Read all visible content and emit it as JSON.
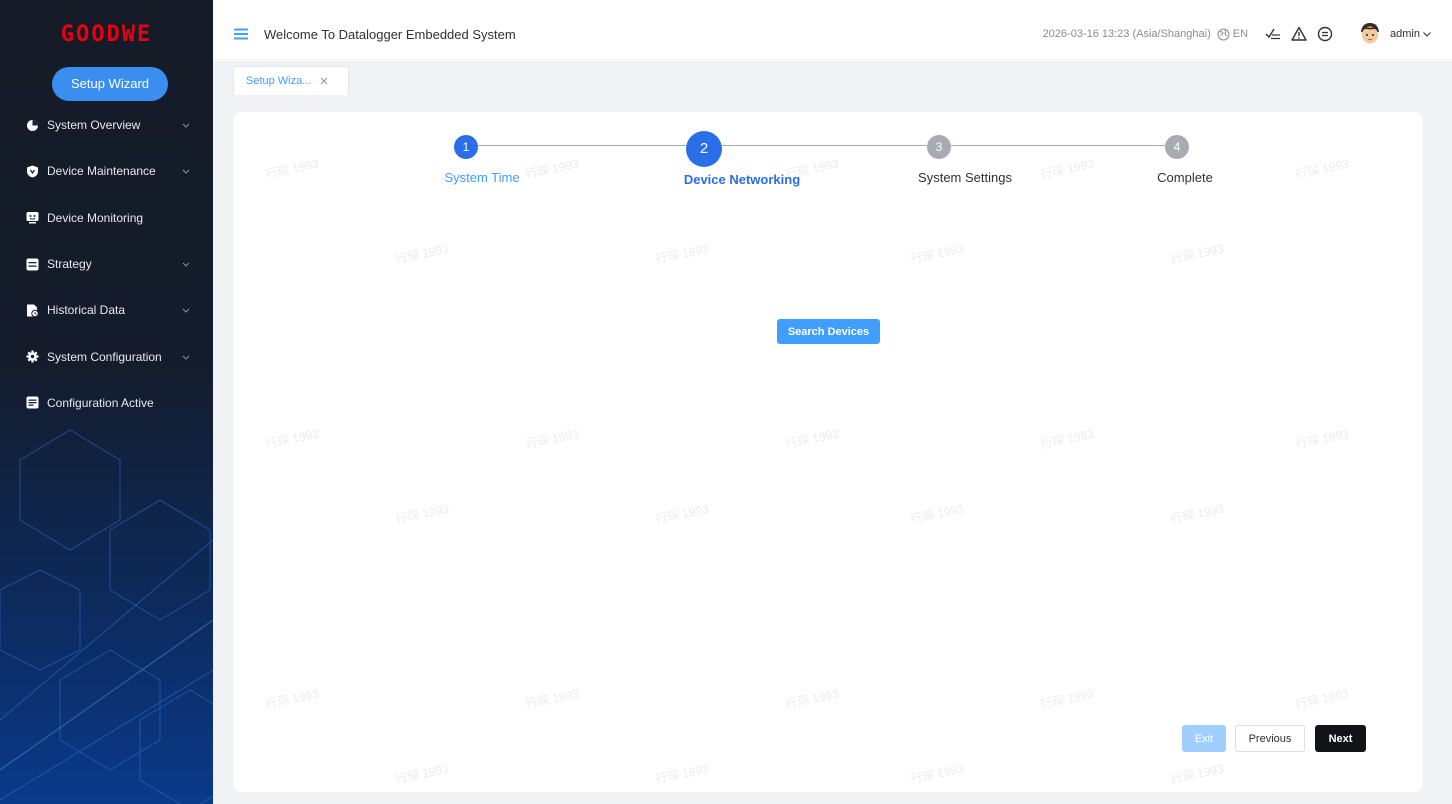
{
  "brand": {
    "logo_text": "GOODWE",
    "logo_color": "#e60012",
    "accent": "#409eff"
  },
  "sidebar": {
    "wizard_button": "Setup Wizard",
    "items": [
      {
        "label": "System Overview",
        "icon": "pie-chart-icon",
        "has_children": true
      },
      {
        "label": "Device Maintenance",
        "icon": "shield-icon",
        "has_children": true
      },
      {
        "label": "Device Monitoring",
        "icon": "monitor-icon",
        "has_children": false
      },
      {
        "label": "Strategy",
        "icon": "strategy-icon",
        "has_children": true
      },
      {
        "label": "Historical Data",
        "icon": "history-icon",
        "has_children": true
      },
      {
        "label": "System Configuration",
        "icon": "gear-icon",
        "has_children": true
      },
      {
        "label": "Configuration Active",
        "icon": "config-active-icon",
        "has_children": false
      }
    ]
  },
  "header": {
    "title": "Welcome To Datalogger Embedded System",
    "datetime": "2026-03-16 13:23 (Asia/Shanghai)",
    "language": "EN",
    "username": "admin"
  },
  "tabs": [
    {
      "label": "Setup Wiza...",
      "active": true
    }
  ],
  "steps": [
    {
      "number": "1",
      "label": "System Time",
      "state": "done"
    },
    {
      "number": "2",
      "label": "Device Networking",
      "state": "active"
    },
    {
      "number": "3",
      "label": "System Settings",
      "state": "pending"
    },
    {
      "number": "4",
      "label": "Complete",
      "state": "pending"
    }
  ],
  "main": {
    "search_button": "Search Devices"
  },
  "footer": {
    "exit_label": "Exit",
    "previous_label": "Previous",
    "next_label": "Next"
  },
  "watermark": "行琛 1993"
}
